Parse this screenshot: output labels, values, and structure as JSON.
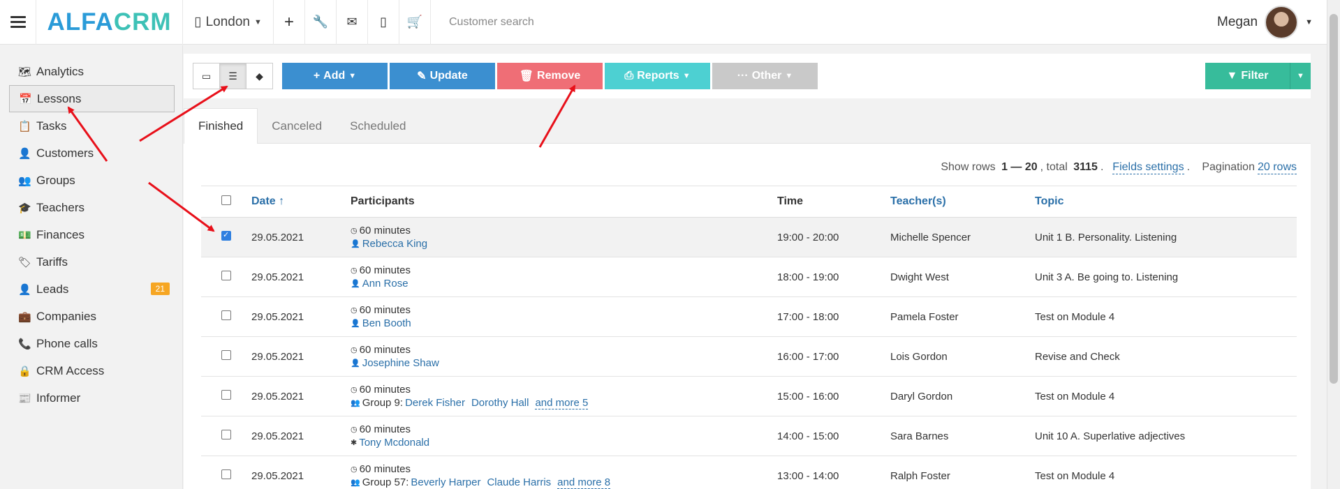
{
  "topbar": {
    "logo_alfa": "ALFA",
    "logo_crm": "CRM",
    "branch": "London",
    "search_placeholder": "Customer search",
    "user_name": "Megan"
  },
  "sidebar": {
    "items": [
      {
        "label": "Analytics",
        "icon": "map-icon",
        "glyph": "🗺"
      },
      {
        "label": "Lessons",
        "icon": "calendar-icon",
        "glyph": "📅"
      },
      {
        "label": "Tasks",
        "icon": "clipboard-icon",
        "glyph": "📋"
      },
      {
        "label": "Customers",
        "icon": "user-icon",
        "glyph": "👤"
      },
      {
        "label": "Groups",
        "icon": "users-icon",
        "glyph": "👥"
      },
      {
        "label": "Teachers",
        "icon": "graduation-cap-icon",
        "glyph": "🎓"
      },
      {
        "label": "Finances",
        "icon": "money-icon",
        "glyph": "💵"
      },
      {
        "label": "Tariffs",
        "icon": "tag-icon",
        "glyph": "🏷"
      },
      {
        "label": "Leads",
        "icon": "user-plus-icon",
        "glyph": "👤",
        "badge": "21"
      },
      {
        "label": "Companies",
        "icon": "briefcase-icon",
        "glyph": "💼"
      },
      {
        "label": "Phone calls",
        "icon": "phone-icon",
        "glyph": "📞"
      },
      {
        "label": "CRM Access",
        "icon": "lock-icon",
        "glyph": "🔒"
      },
      {
        "label": "Informer",
        "icon": "newspaper-icon",
        "glyph": "📰"
      }
    ]
  },
  "toolbar": {
    "add": "Add",
    "update": "Update",
    "remove": "Remove",
    "reports": "Reports",
    "other": "Other",
    "filter": "Filter"
  },
  "tabs": [
    "Finished",
    "Canceled",
    "Scheduled"
  ],
  "rowinfo": {
    "show_rows": "Show rows ",
    "range": "1 — 20",
    "total_label": ", total ",
    "total": "3115",
    "fields_settings": "Fields settings",
    "pagination_label": "Pagination",
    "pagination_value": "20 rows"
  },
  "table": {
    "headers": {
      "date": "Date ↑",
      "participants": "Participants",
      "time": "Time",
      "teachers": "Teacher(s)",
      "topic": "Topic"
    },
    "rows": [
      {
        "checked": true,
        "date": "29.05.2021",
        "duration": "60 minutes",
        "participant_kind": "single",
        "prefix": "",
        "names": [
          "Rebecca King"
        ],
        "more": "",
        "time": "19:00 - 20:00",
        "teacher": "Michelle Spencer",
        "topic": "Unit 1 B. Personality. Listening"
      },
      {
        "checked": false,
        "date": "29.05.2021",
        "duration": "60 minutes",
        "participant_kind": "single",
        "prefix": "",
        "names": [
          "Ann Rose"
        ],
        "more": "",
        "time": "18:00 - 19:00",
        "teacher": "Dwight West",
        "topic": "Unit 3 A. Be going to. Listening"
      },
      {
        "checked": false,
        "date": "29.05.2021",
        "duration": "60 minutes",
        "participant_kind": "single",
        "prefix": "",
        "names": [
          "Ben Booth"
        ],
        "more": "",
        "time": "17:00 - 18:00",
        "teacher": "Pamela Foster",
        "topic": "Test on Module 4"
      },
      {
        "checked": false,
        "date": "29.05.2021",
        "duration": "60 minutes",
        "participant_kind": "single",
        "prefix": "",
        "names": [
          "Josephine Shaw"
        ],
        "more": "",
        "time": "16:00 - 17:00",
        "teacher": "Lois Gordon",
        "topic": "Revise and Check"
      },
      {
        "checked": false,
        "date": "29.05.2021",
        "duration": "60 minutes",
        "participant_kind": "group",
        "prefix": "Group 9:",
        "names": [
          "Derek Fisher",
          "Dorothy Hall"
        ],
        "more": "and more 5",
        "time": "15:00 - 16:00",
        "teacher": "Daryl Gordon",
        "topic": "Test on Module 4"
      },
      {
        "checked": false,
        "date": "29.05.2021",
        "duration": "60 minutes",
        "participant_kind": "asterisk",
        "prefix": "",
        "names": [
          "Tony Mcdonald"
        ],
        "more": "",
        "time": "14:00 - 15:00",
        "teacher": "Sara Barnes",
        "topic": "Unit 10 A. Superlative adjectives"
      },
      {
        "checked": false,
        "date": "29.05.2021",
        "duration": "60 minutes",
        "participant_kind": "group",
        "prefix": "Group 57:",
        "names": [
          "Beverly Harper",
          "Claude Harris"
        ],
        "more": "and more 8",
        "time": "13:00 - 14:00",
        "teacher": "Ralph Foster",
        "topic": "Test on Module 4"
      }
    ]
  },
  "colors": {
    "primary": "#3b8fd0",
    "remove": "#ef6e76",
    "reports": "#4dd0d2",
    "other": "#c9c9c9",
    "filter": "#37bc9b",
    "badge": "#f6a623",
    "arrow": "#e8101a"
  }
}
